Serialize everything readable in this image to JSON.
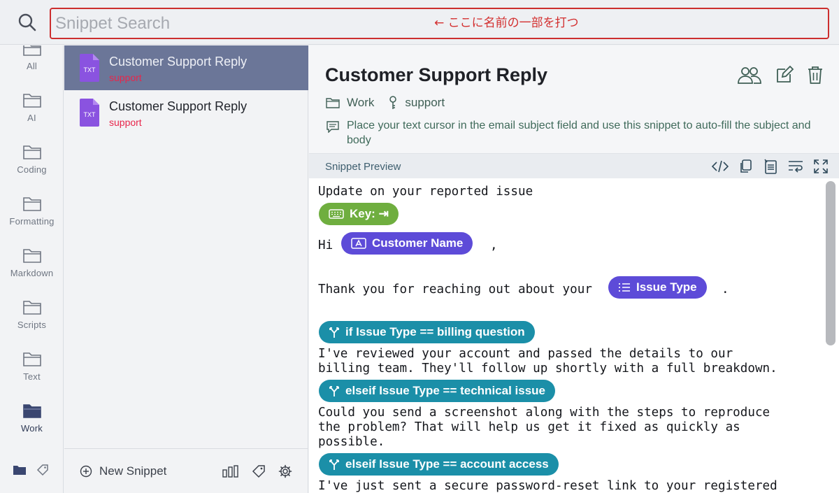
{
  "search": {
    "placeholder": "Snippet Search",
    "hint": "← ここに名前の一部を打つ"
  },
  "folders": [
    {
      "label": "All",
      "icon": "folder-outline-icon"
    },
    {
      "label": "AI",
      "icon": "folder-outline-icon"
    },
    {
      "label": "Coding",
      "icon": "folder-outline-icon"
    },
    {
      "label": "Formatting",
      "icon": "folder-outline-icon"
    },
    {
      "label": "Markdown",
      "icon": "folder-outline-icon"
    },
    {
      "label": "Scripts",
      "icon": "folder-outline-icon"
    },
    {
      "label": "Text",
      "icon": "folder-outline-icon"
    },
    {
      "label": "Work",
      "icon": "folder-filled-icon",
      "active": true
    }
  ],
  "snippets": [
    {
      "title": "Customer Support Reply",
      "tag": "support",
      "type": "TXT",
      "selected": true
    },
    {
      "title": "Customer Support Reply",
      "tag": "support",
      "type": "TXT",
      "selected": false
    }
  ],
  "list_footer": {
    "new_snippet": "New Snippet"
  },
  "detail": {
    "title": "Customer Support Reply",
    "folder": "Work",
    "keyword": "support",
    "description": "Place your text cursor in the email subject field and use this snippet to auto-fill the subject and body",
    "preview_label": "Snippet Preview"
  },
  "preview": {
    "line1": "Update on your reported issue",
    "key_pill": "Key: ⇥",
    "hi": "Hi",
    "name_pill": "Customer Name",
    "comma": ",",
    "thanks": "Thank you for reaching out about your",
    "issue_pill": "Issue Type",
    "period": ".",
    "if1": "if Issue Type == billing question",
    "body1a": "I've reviewed your account and passed the details to our",
    "body1b": "billing team. They'll follow up shortly with a full breakdown.",
    "if2": "elseif Issue Type == technical issue",
    "body2a": "Could you send a screenshot along with the steps to reproduce",
    "body2b": "the problem? That will help us get it fixed as quickly as",
    "body2c": "possible.",
    "if3": "elseif Issue Type == account access",
    "body3a": "I've just sent a secure password-reset link to your registered"
  },
  "colors": {
    "selected_row": "#6b7698",
    "tag": "#e8264b",
    "pill_key": "#6fae3f",
    "pill_field": "#5d4bd8",
    "pill_condition": "#1b8fa8",
    "search_border": "#cc2e2e"
  }
}
